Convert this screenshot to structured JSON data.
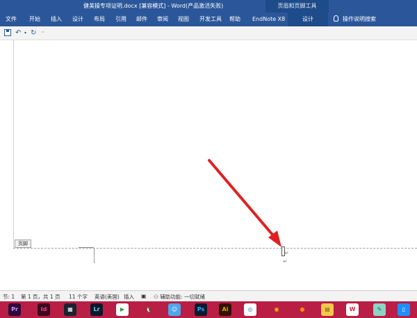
{
  "window": {
    "title": "健美操专项证明.docx [兼容模式] - Word(产品激活失败)",
    "context_tab_group": "页眉和页脚工具"
  },
  "ribbon": {
    "tabs": [
      "文件",
      "开始",
      "插入",
      "设计",
      "布局",
      "引用",
      "邮件",
      "审阅",
      "视图",
      "开发工具",
      "帮助",
      "EndNote X8",
      "设计"
    ],
    "tell_me": "操作说明搜索"
  },
  "document": {
    "footer_label": "页脚",
    "paragraph_mark": "↵"
  },
  "statusbar": {
    "section": "节: 1",
    "page": "第 1 页，共 1 页",
    "words": "11 个字",
    "language": "英语(美国)",
    "mode": "插入",
    "accessibility": "辅助功能: 一切就绪"
  },
  "taskbar": {
    "apps": [
      {
        "name": "premiere",
        "label": "Pr",
        "color": "#2a0a3a",
        "fg": "#e38cff"
      },
      {
        "name": "indesign",
        "label": "Id",
        "color": "#3a0a1e",
        "fg": "#ff3b8d"
      },
      {
        "name": "video-editor",
        "label": "▦",
        "color": "#1b2230",
        "fg": "#ffffff"
      },
      {
        "name": "lightroom",
        "label": "Lr",
        "color": "#0a1a2a",
        "fg": "#7fc4ff"
      },
      {
        "name": "media-player",
        "label": "▶",
        "color": "#ffffff",
        "fg": "#2a9d3a"
      },
      {
        "name": "qq",
        "label": "🐧",
        "color": "#b91e44",
        "fg": "#000000"
      },
      {
        "name": "finder",
        "label": "☺",
        "color": "#4ea6ee",
        "fg": "#ffffff"
      },
      {
        "name": "photoshop",
        "label": "Ps",
        "color": "#0b1a2e",
        "fg": "#31a8ff"
      },
      {
        "name": "illustrator",
        "label": "Ai",
        "color": "#2e1400",
        "fg": "#ff9a00"
      },
      {
        "name": "browser-360",
        "label": "◎",
        "color": "#ffffff",
        "fg": "#1e7fd6"
      },
      {
        "name": "chrome",
        "label": "◉",
        "color": "#b91e44",
        "fg": "#f4c20d"
      },
      {
        "name": "firefox",
        "label": "●",
        "color": "#b91e44",
        "fg": "#ff8a00"
      },
      {
        "name": "file-explorer",
        "label": "▤",
        "color": "#f2c94c",
        "fg": "#7a5a00"
      },
      {
        "name": "wps",
        "label": "W",
        "color": "#ffffff",
        "fg": "#d9263a"
      },
      {
        "name": "notes",
        "label": "✎",
        "color": "#8fd3c6",
        "fg": "#1d5a50"
      },
      {
        "name": "phone",
        "label": "▯",
        "color": "#1f8fff",
        "fg": "#ffffff"
      }
    ]
  }
}
